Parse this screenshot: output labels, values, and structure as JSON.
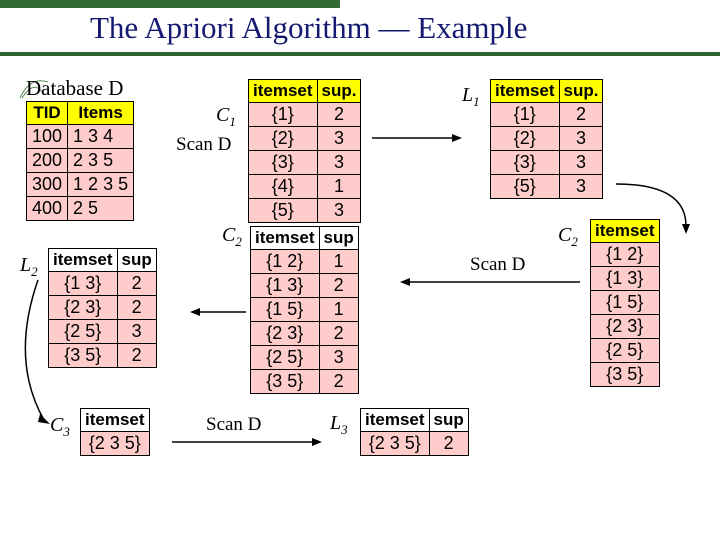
{
  "title": "The Apriori Algorithm — Example",
  "database_label": "Database D",
  "scan_label": "Scan D",
  "labels": {
    "C1": "C",
    "C1s": "1",
    "L1": "L",
    "L1s": "1",
    "C2": "C",
    "C2s": "2",
    "L2": "L",
    "L2s": "2",
    "C3": "C",
    "C3s": "3",
    "L3": "L",
    "L3s": "3"
  },
  "db": {
    "headers": [
      "TID",
      "Items"
    ],
    "rows": [
      [
        "100",
        "1 3 4"
      ],
      [
        "200",
        "2 3 5"
      ],
      [
        "300",
        "1 2 3 5"
      ],
      [
        "400",
        "2 5"
      ]
    ]
  },
  "c1": {
    "headers": [
      "itemset",
      "sup."
    ],
    "rows": [
      [
        "{1}",
        "2"
      ],
      [
        "{2}",
        "3"
      ],
      [
        "{3}",
        "3"
      ],
      [
        "{4}",
        "1"
      ],
      [
        "{5}",
        "3"
      ]
    ]
  },
  "l1": {
    "headers": [
      "itemset",
      "sup."
    ],
    "rows": [
      [
        "{1}",
        "2"
      ],
      [
        "{2}",
        "3"
      ],
      [
        "{3}",
        "3"
      ],
      [
        "{5}",
        "3"
      ]
    ]
  },
  "c2_list": {
    "headers": [
      "itemset"
    ],
    "rows": [
      [
        "{1 2}"
      ],
      [
        "{1 3}"
      ],
      [
        "{1 5}"
      ],
      [
        "{2 3}"
      ],
      [
        "{2 5}"
      ],
      [
        "{3 5}"
      ]
    ]
  },
  "c2_sup": {
    "headers": [
      "itemset",
      "sup"
    ],
    "rows": [
      [
        "{1 2}",
        "1"
      ],
      [
        "{1 3}",
        "2"
      ],
      [
        "{1 5}",
        "1"
      ],
      [
        "{2 3}",
        "2"
      ],
      [
        "{2 5}",
        "3"
      ],
      [
        "{3 5}",
        "2"
      ]
    ]
  },
  "l2": {
    "headers": [
      "itemset",
      "sup"
    ],
    "rows": [
      [
        "{1 3}",
        "2"
      ],
      [
        "{2 3}",
        "2"
      ],
      [
        "{2 5}",
        "3"
      ],
      [
        "{3 5}",
        "2"
      ]
    ]
  },
  "c3": {
    "headers": [
      "itemset"
    ],
    "rows": [
      [
        "{2 3 5}"
      ]
    ]
  },
  "l3": {
    "headers": [
      "itemset",
      "sup"
    ],
    "rows": [
      [
        "{2 3 5}",
        "2"
      ]
    ]
  }
}
